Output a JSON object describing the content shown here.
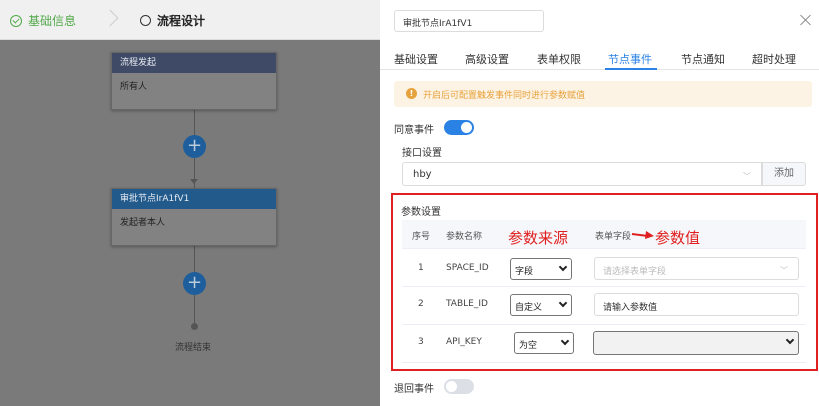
{
  "steps": {
    "step1": "基础信息",
    "step2": "流程设计"
  },
  "flow": {
    "node1": {
      "title": "流程发起",
      "body": "所有人"
    },
    "node2": {
      "title": "审批节点IrA1fV1",
      "body": "发起者本人"
    },
    "add_symbol": "+",
    "end_label": "流程结束"
  },
  "drawer": {
    "title_value": "审批节点IrA1fV1",
    "tabs": [
      "基础设置",
      "高级设置",
      "表单权限",
      "节点事件",
      "节点通知",
      "超时处理"
    ],
    "active_tab": "节点事件",
    "notice": "开启后可配置触发事件同时进行参数赋值",
    "agree_event_label": "同意事件",
    "agree_event_on": true,
    "interface_label": "接口设置",
    "interface_value": "hby",
    "add_label": "添加",
    "params_title": "参数设置",
    "table_headers": {
      "index": "序号",
      "name": "参数名称",
      "field": "表单字段"
    },
    "annotations": {
      "source": "参数来源",
      "value": "参数值"
    },
    "rows": [
      {
        "index": "1",
        "name": "SPACE_ID",
        "source": "字段",
        "value": "",
        "value_placeholder": "请选择表单字段"
      },
      {
        "index": "2",
        "name": "TABLE_ID",
        "source": "自定义",
        "value": "请输入参数值"
      },
      {
        "index": "3",
        "name": "API_KEY",
        "source": "为空",
        "value": ""
      }
    ],
    "reject_event_label": "退回事件",
    "reject_event_on": false
  },
  "colors": {
    "accent": "#2a82e4",
    "annotation_red": "#e02020",
    "success": "#52a84a",
    "warning": "#e6a23c"
  }
}
